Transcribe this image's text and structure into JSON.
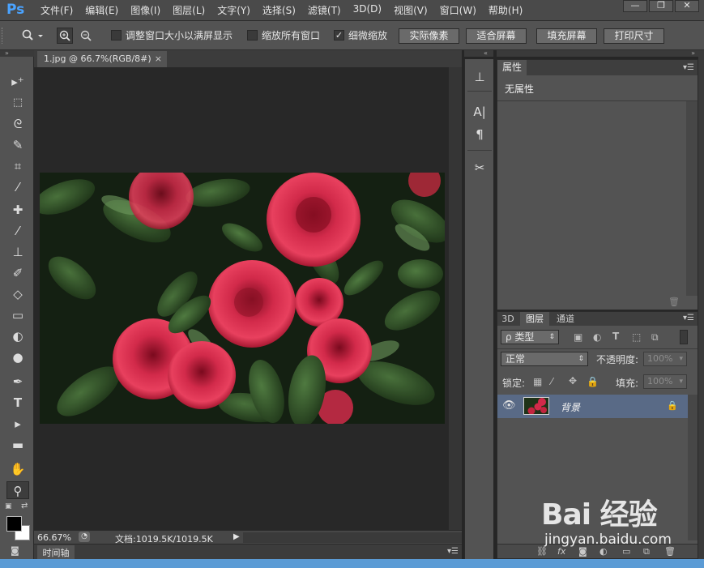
{
  "app": {
    "logo": "Ps"
  },
  "menu": [
    "文件(F)",
    "编辑(E)",
    "图像(I)",
    "图层(L)",
    "文字(Y)",
    "选择(S)",
    "滤镜(T)",
    "3D(D)",
    "视图(V)",
    "窗口(W)",
    "帮助(H)"
  ],
  "window_controls": {
    "minimize": "—",
    "restore": "❐",
    "close": "✕"
  },
  "options": {
    "resize_windows": {
      "label": "调整窗口大小以满屏显示",
      "checked": false
    },
    "zoom_all": {
      "label": "缩放所有窗口",
      "checked": false
    },
    "scrubby_zoom": {
      "label": "细微缩放",
      "checked": true
    },
    "buttons": [
      "实际像素",
      "适合屏幕",
      "填充屏幕",
      "打印尺寸"
    ]
  },
  "document": {
    "tab_title": "1.jpg @ 66.7%(RGB/8#)"
  },
  "status": {
    "zoom": "66.67%",
    "doc_info": "文档:1019.5K/1019.5K"
  },
  "timeline": {
    "label": "时间轴"
  },
  "properties": {
    "tab": "属性",
    "body": "无属性"
  },
  "layers": {
    "tabs": [
      "3D",
      "图层",
      "通道"
    ],
    "active_tab": "图层",
    "filter_label": "ρ 类型",
    "blend_mode": "正常",
    "opacity_label": "不透明度:",
    "opacity_value": "100%",
    "lock_label": "锁定:",
    "fill_label": "填充:",
    "fill_value": "100%",
    "layer_name": "背景"
  },
  "watermark": {
    "logo": "Bai  经验",
    "url": "jingyan.baidu.com"
  },
  "icons": {
    "tools": [
      "move-icon",
      "marquee-icon",
      "lasso-icon",
      "quick-select-icon",
      "crop-icon",
      "eyedropper-icon",
      "healing-brush-icon",
      "brush-icon",
      "clone-stamp-icon",
      "history-brush-icon",
      "eraser-icon",
      "gradient-icon",
      "blur-icon",
      "dodge-icon",
      "pen-icon",
      "type-icon",
      "path-select-icon",
      "rectangle-icon",
      "hand-icon",
      "zoom-icon"
    ]
  },
  "colors": {
    "foreground": "#000000",
    "background": "#ffffff",
    "accent": "#596a86"
  }
}
